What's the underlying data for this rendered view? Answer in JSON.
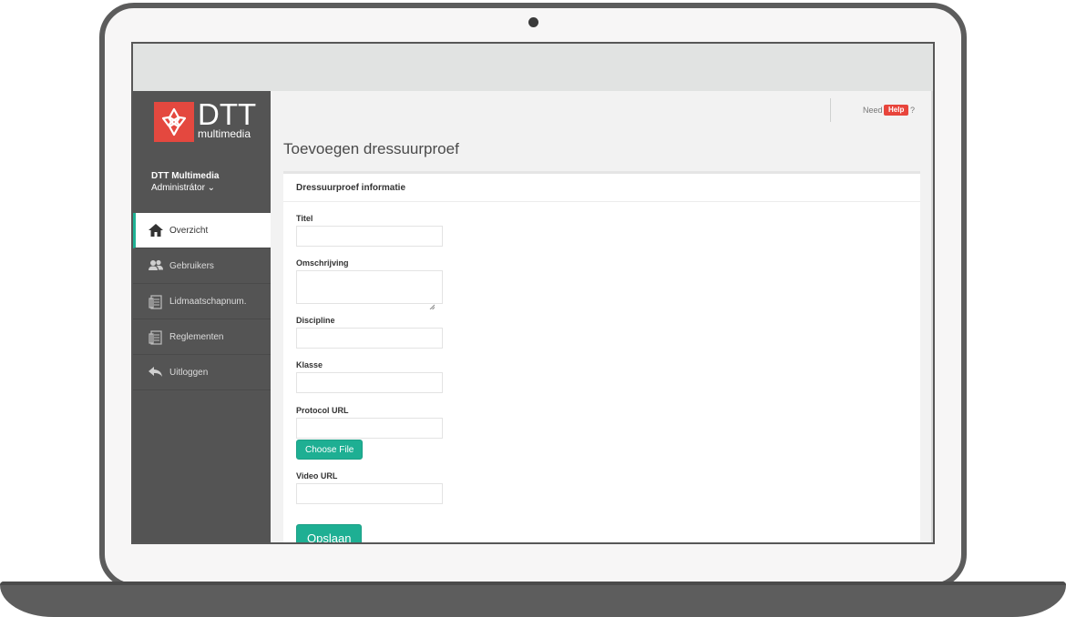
{
  "brand": {
    "logo_text": "DTT",
    "logo_sub": "multimedia",
    "accent_color": "#1fb295",
    "logo_color": "#e4483f"
  },
  "user": {
    "name": "DTT Multimedia",
    "role": "Administrátor ⌄"
  },
  "sidebar": {
    "items": [
      {
        "label": "Overzicht",
        "icon": "home-icon",
        "active": true
      },
      {
        "label": "Gebruikers",
        "icon": "users-icon",
        "active": false
      },
      {
        "label": "Lidmaatschapnum.",
        "icon": "document-icon",
        "active": false
      },
      {
        "label": "Reglementen",
        "icon": "document-icon",
        "active": false
      },
      {
        "label": "Uitloggen",
        "icon": "reply-icon",
        "active": false
      }
    ]
  },
  "header": {
    "need": "Need",
    "help": "Help",
    "qmark": "?"
  },
  "page": {
    "title": "Toevoegen dressuurproef",
    "panel_title": "Dressuurproef informatie"
  },
  "form": {
    "titel_label": "Titel",
    "omschrijving_label": "Omschrijving",
    "discipline_label": "Discipline",
    "klasse_label": "Klasse",
    "protocol_label": "Protocol URL",
    "choose_file": "Choose File",
    "video_label": "Video URL",
    "save": "Opslaan"
  }
}
